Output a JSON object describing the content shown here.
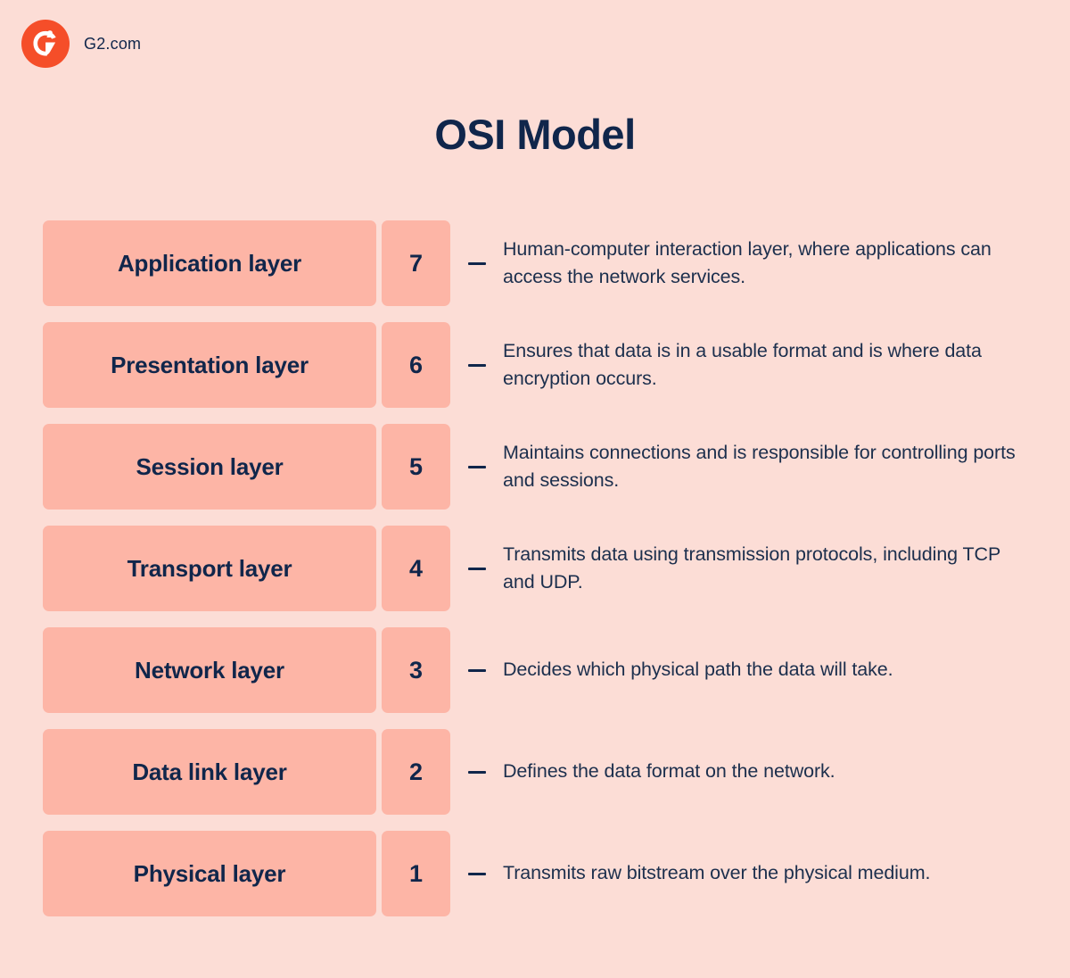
{
  "brand": {
    "logo_icon": "g2-logo-icon",
    "name": "G2.com",
    "logo_color": "#F54E29"
  },
  "header": {
    "title": "OSI Model"
  },
  "colors": {
    "background": "#FCDDD6",
    "box": "#FDB5A6",
    "text": "#10264B",
    "accent": "#F54E29"
  },
  "layers": [
    {
      "name": "Application layer",
      "number": "7",
      "description": "Human-computer interaction layer, where applications can access the network services."
    },
    {
      "name": "Presentation layer",
      "number": "6",
      "description": "Ensures that data is in a usable format and is where data encryption occurs."
    },
    {
      "name": "Session layer",
      "number": "5",
      "description": "Maintains connections and is responsible for controlling ports and sessions."
    },
    {
      "name": "Transport layer",
      "number": "4",
      "description": "Transmits data using transmission protocols, including TCP and UDP."
    },
    {
      "name": "Network layer",
      "number": "3",
      "description": "Decides which physical path the data will take."
    },
    {
      "name": "Data link layer",
      "number": "2",
      "description": "Defines the data format on the network."
    },
    {
      "name": "Physical layer",
      "number": "1",
      "description": "Transmits raw bitstream over the physical medium."
    }
  ]
}
